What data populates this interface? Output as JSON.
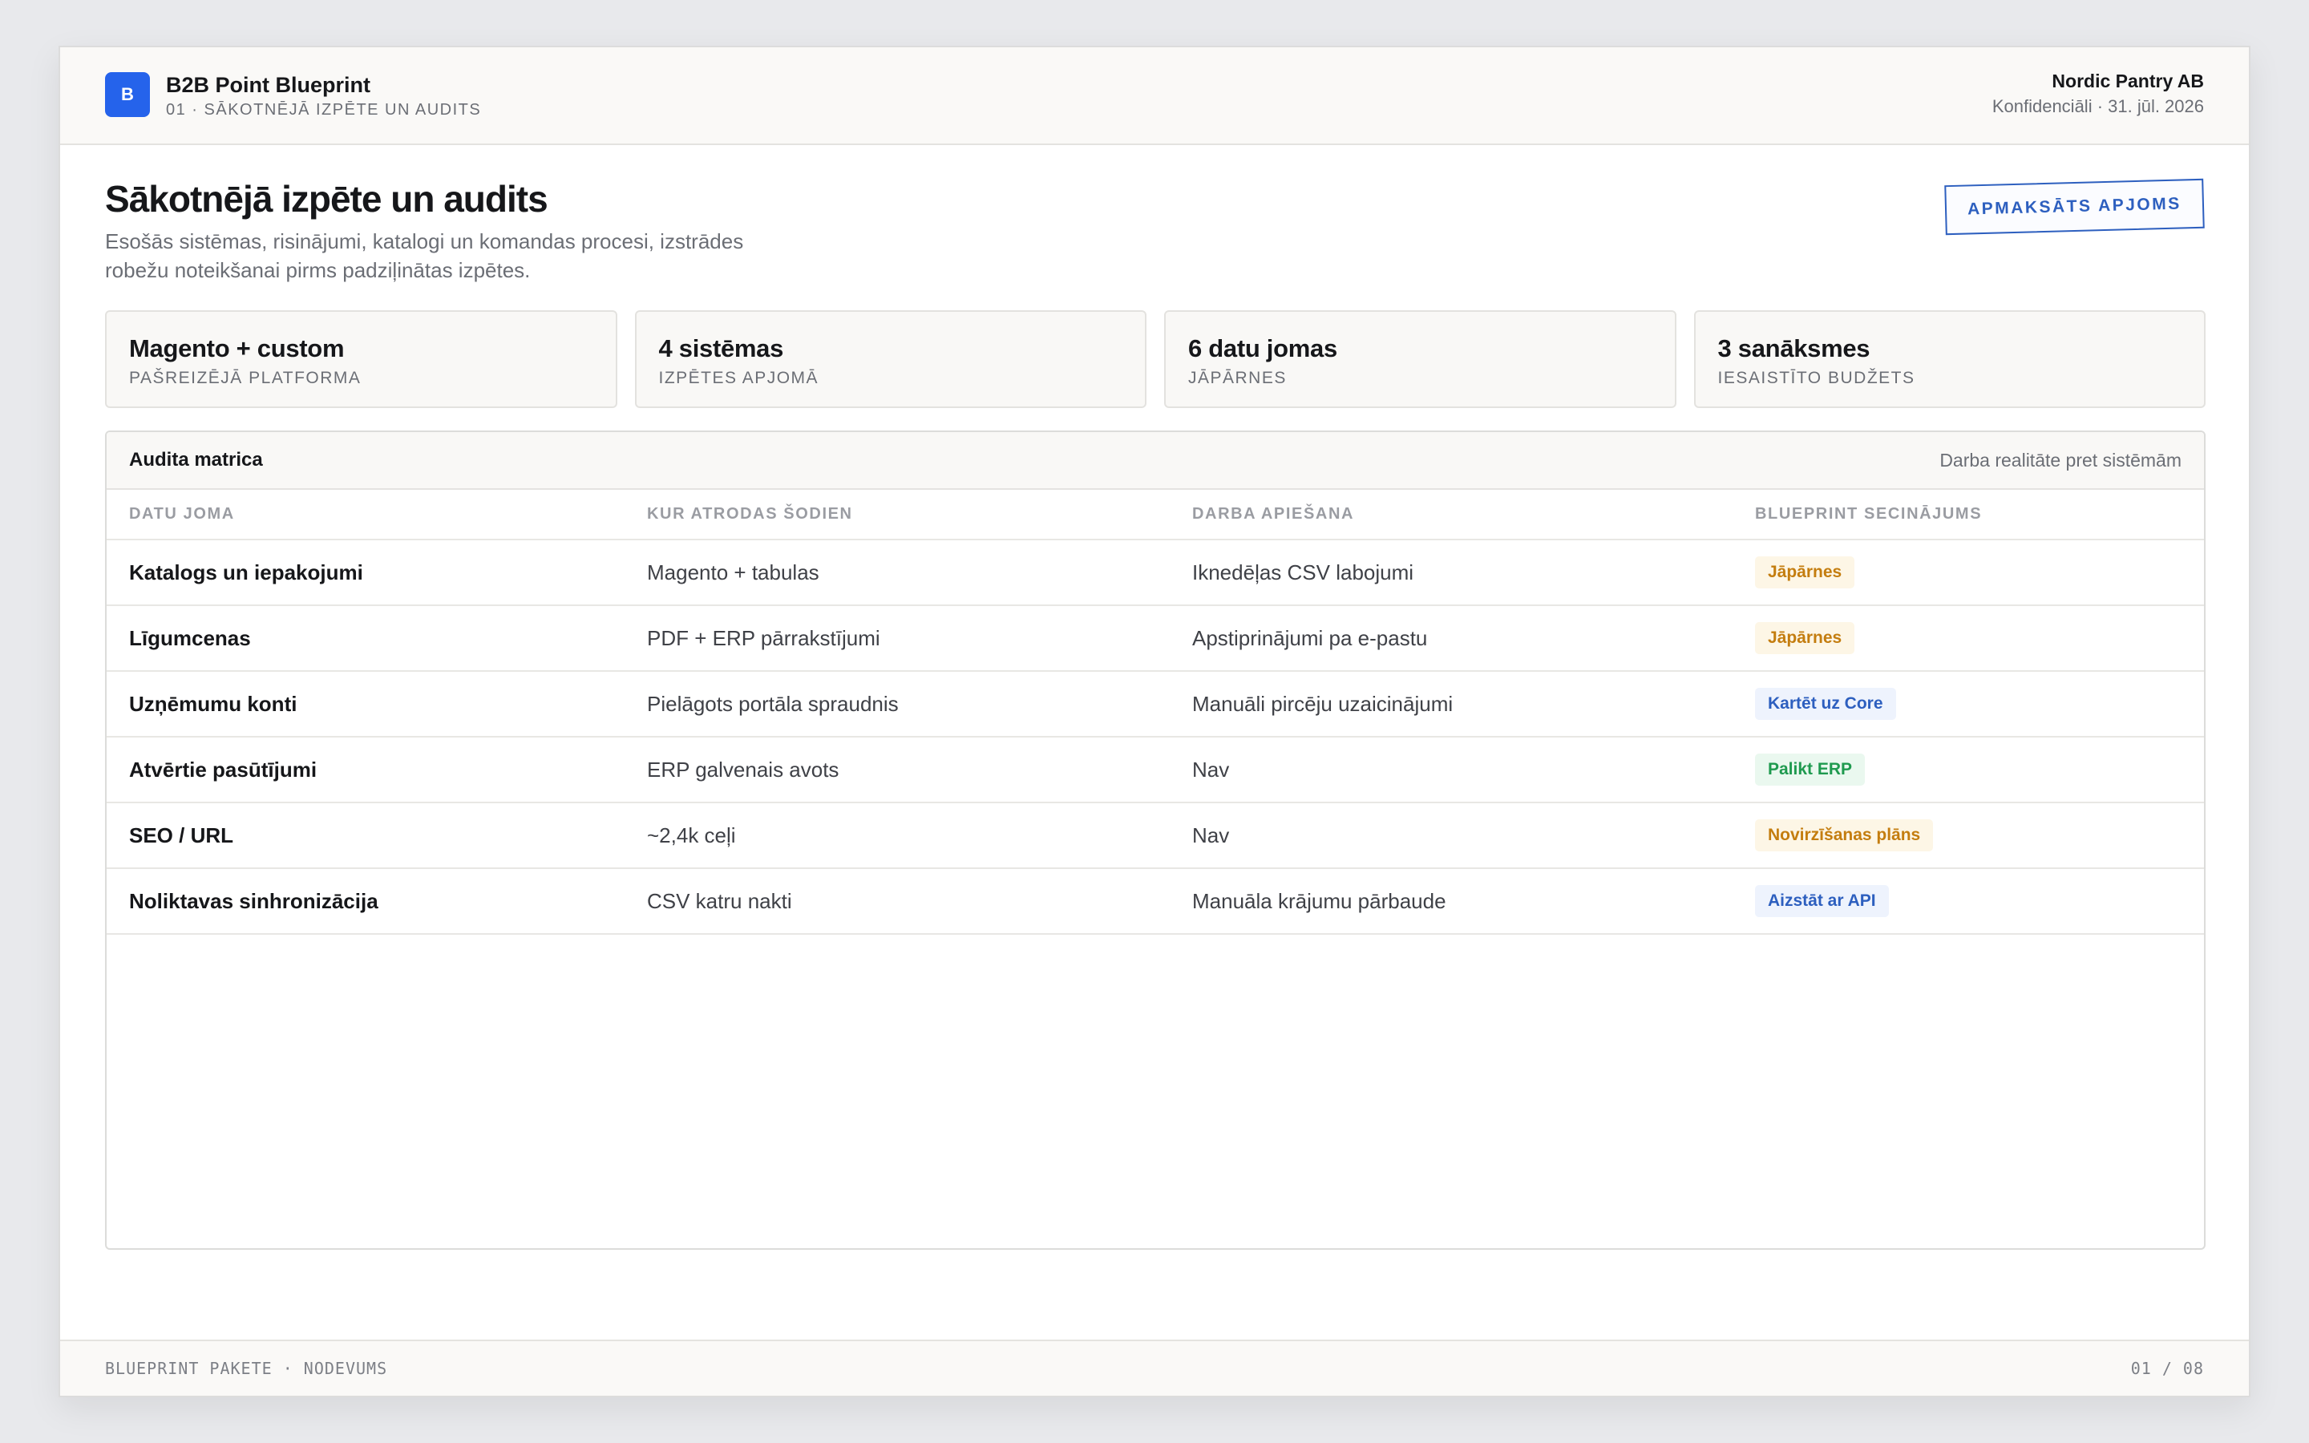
{
  "header": {
    "logo_letter": "B",
    "brand_name": "B2B Point Blueprint",
    "breadcrumb": "01 · SĀKOTNĒJĀ IZPĒTE UN AUDITS",
    "client": "Nordic Pantry AB",
    "confidential": "Konfidenciāli · 31. jūl. 2026"
  },
  "main": {
    "title": "Sākotnējā izpēte un audits",
    "subtitle": "Esošās sistēmas, risinājumi, katalogi un komandas procesi, izstrādes robežu noteikšanai pirms padziļinātas izpētes.",
    "stamp": "APMAKSĀTS APJOMS"
  },
  "stats": [
    {
      "value": "Magento + custom",
      "label": "PAŠREIZĒJĀ PLATFORMA"
    },
    {
      "value": "4 sistēmas",
      "label": "IZPĒTES APJOMĀ"
    },
    {
      "value": "6 datu jomas",
      "label": "JĀPĀRNES"
    },
    {
      "value": "3 sanāksmes",
      "label": "IESAISTĪTO BUDŽETS"
    }
  ],
  "audit": {
    "title": "Audita matrica",
    "note": "Darba realitāte pret sistēmām",
    "columns": [
      "DATU JOMA",
      "KUR ATRODAS ŠODIEN",
      "DARBA APIEŠANA",
      "BLUEPRINT SECINĀJUMS"
    ],
    "rows": [
      {
        "area": "Katalogs un iepakojumi",
        "location": "Magento + tabulas",
        "workaround": "Iknedēļas CSV labojumi",
        "verdict": "Jāpārnes",
        "tone": "amber"
      },
      {
        "area": "Līgumcenas",
        "location": "PDF + ERP pārrakstījumi",
        "workaround": "Apstiprinājumi pa e-pastu",
        "verdict": "Jāpārnes",
        "tone": "amber"
      },
      {
        "area": "Uzņēmumu konti",
        "location": "Pielāgots portāla spraudnis",
        "workaround": "Manuāli pircēju uzaicinājumi",
        "verdict": "Kartēt uz Core",
        "tone": "blue"
      },
      {
        "area": "Atvērtie pasūtījumi",
        "location": "ERP galvenais avots",
        "workaround": "Nav",
        "verdict": "Palikt ERP",
        "tone": "green"
      },
      {
        "area": "SEO / URL",
        "location": "~2,4k ceļi",
        "workaround": "Nav",
        "verdict": "Novirzīšanas plāns",
        "tone": "amber"
      },
      {
        "area": "Noliktavas sinhronizācija",
        "location": "CSV katru nakti",
        "workaround": "Manuāla krājumu pārbaude",
        "verdict": "Aizstāt ar API",
        "tone": "blue"
      }
    ]
  },
  "footer": {
    "left": "BLUEPRINT PAKETE · NODEVUMS",
    "right": "01 / 08"
  },
  "colors": {
    "accent": "#2563eb",
    "amber": "#c47d0f",
    "blue": "#2d5fbf",
    "green": "#1f9a4f"
  }
}
